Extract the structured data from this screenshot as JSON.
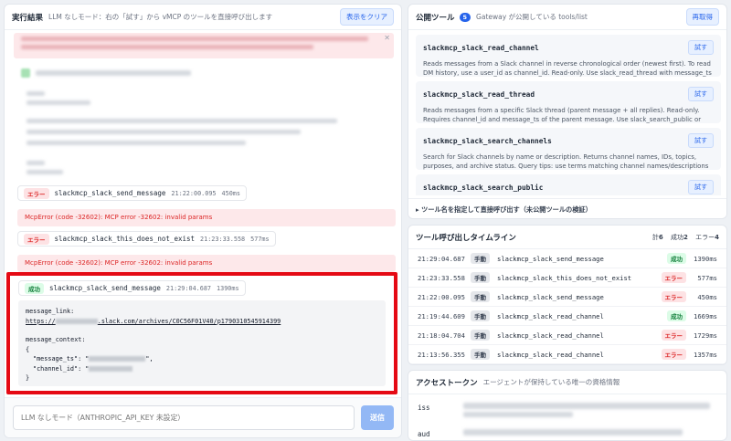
{
  "results": {
    "title": "実行結果",
    "subtitle": "LLM なしモード：右の「試す」から vMCP のツールを直接呼び出します",
    "clear_label": "表示をクリア",
    "entries": [
      {
        "status": "エラー",
        "name": "slackmcp_slack_send_message",
        "time": "21:22:00.095",
        "duration": "450ms",
        "error": "McpError (code -32602): MCP error -32602: invalid params"
      },
      {
        "status": "エラー",
        "name": "slackmcp_slack_this_does_not_exist",
        "time": "21:23:33.558",
        "duration": "577ms",
        "error": "McpError (code -32602): MCP error -32602: invalid params"
      },
      {
        "status": "成功",
        "name": "slackmcp_slack_send_message",
        "time": "21:29:04.687",
        "duration": "1390ms"
      }
    ],
    "detail": {
      "line1": "message_link:",
      "link_prefix": "https://",
      "link_suffix": ".slack.com/archives/C0C56F01V40/p1790310545914399",
      "line3": "message_context:",
      "brace_open": "{",
      "ts_key": "\"message_ts\": \"",
      "ts_end": "\",",
      "ch_key": "\"channel_id\": \"",
      "brace_close": "}"
    },
    "input_placeholder": "LLM なしモード（ANTHROPIC_API_KEY 未設定）",
    "send_label": "送信"
  },
  "tools": {
    "title": "公開ツール",
    "count": "5",
    "subtitle": "Gateway が公開している tools/list",
    "refresh_label": "再取得",
    "try_label": "試す",
    "items": [
      {
        "name": "slackmcp_slack_read_channel",
        "desc": "Reads messages from a Slack channel in reverse chronological order (newest first). To read DM history, use a user_id as channel_id. Read-only. Use slack_read_thread with message_ts to read…"
      },
      {
        "name": "slackmcp_slack_read_thread",
        "desc": "Reads messages from a specific Slack thread (parent message + all replies). Read-only. Requires channel_id and message_ts of the parent message. Use slack_search_public or slack_read_channel…"
      },
      {
        "name": "slackmcp_slack_search_channels",
        "desc": "Search for Slack channels by name or description. Returns channel names, IDs, topics, purposes, and archive status. Query tips: use terms matching channel names/descriptions (e.g., \"engineering\",…"
      },
      {
        "name": "slackmcp_slack_search_public",
        "desc": ""
      }
    ],
    "direct_call": "▸ ツール名を指定して直接呼び出す（未公開ツールの検証）"
  },
  "timeline": {
    "title": "ツール呼び出しタイムライン",
    "total_label": "計",
    "total": "6",
    "success_label": "成功",
    "success": "2",
    "error_label": "エラー",
    "error": "4",
    "rows": [
      {
        "time": "21:29:04.687",
        "mode": "手動",
        "name": "slackmcp_slack_send_message",
        "status": "成功",
        "ok": true,
        "dur": "1390ms"
      },
      {
        "time": "21:23:33.558",
        "mode": "手動",
        "name": "slackmcp_slack_this_does_not_exist",
        "status": "エラー",
        "ok": false,
        "dur": "577ms"
      },
      {
        "time": "21:22:00.095",
        "mode": "手動",
        "name": "slackmcp_slack_send_message",
        "status": "エラー",
        "ok": false,
        "dur": "450ms"
      },
      {
        "time": "21:19:44.609",
        "mode": "手動",
        "name": "slackmcp_slack_read_channel",
        "status": "成功",
        "ok": true,
        "dur": "1669ms"
      },
      {
        "time": "21:18:04.704",
        "mode": "手動",
        "name": "slackmcp_slack_read_channel",
        "status": "エラー",
        "ok": false,
        "dur": "1729ms"
      },
      {
        "time": "21:13:56.355",
        "mode": "手動",
        "name": "slackmcp_slack_read_channel",
        "status": "エラー",
        "ok": false,
        "dur": "1357ms"
      }
    ]
  },
  "token": {
    "title": "アクセストークン",
    "subtitle": "エージェントが保持している唯一の資格情報",
    "claim1": "iss",
    "claim2": "aud"
  },
  "colors": {
    "highlight": "#e50914",
    "accent": "#2563eb",
    "error": "#dc2626",
    "success": "#15803d"
  }
}
